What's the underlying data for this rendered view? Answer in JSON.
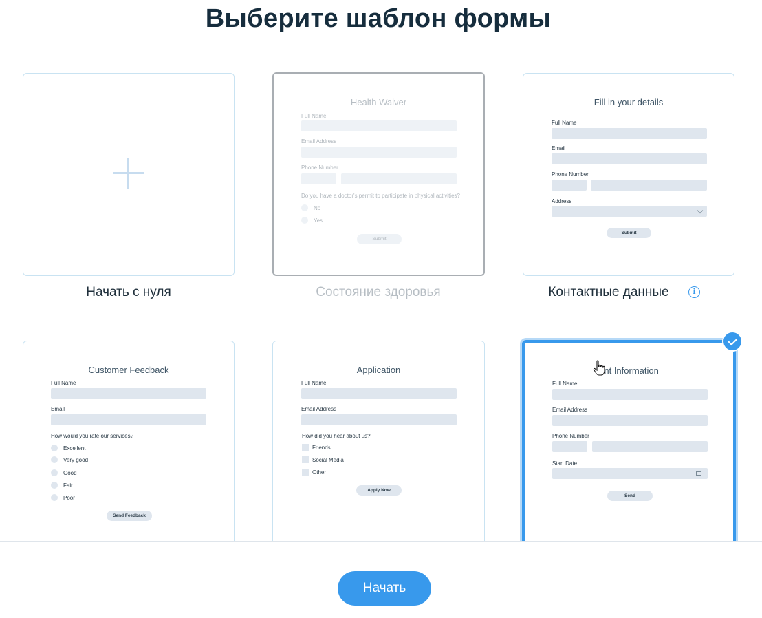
{
  "header": {
    "title": "Выберите шаблон формы"
  },
  "templates": [
    {
      "caption": "Начать с нуля"
    },
    {
      "caption": "Состояние здоровья",
      "form_title": "Health Waiver",
      "labels": [
        "Full Name",
        "Email Address",
        "Phone Number"
      ],
      "question": "Do you have a doctor's permit to participate in physical activities?",
      "options": [
        "No",
        "Yes"
      ],
      "button": "Submit"
    },
    {
      "caption": "Контактные данные",
      "form_title": "Fill in your details",
      "labels": [
        "Full Name",
        "Email",
        "Phone Number",
        "Address"
      ],
      "button": "Submit"
    },
    {
      "form_title": "Customer Feedback",
      "labels": [
        "Full Name",
        "Email"
      ],
      "question": "How would you rate our services?",
      "options": [
        "Excellent",
        "Very good",
        "Good",
        "Fair",
        "Poor"
      ],
      "button": "Send Feedback"
    },
    {
      "form_title": "Application",
      "labels": [
        "Full Name",
        "Email Address"
      ],
      "question": "How did you hear about us?",
      "options": [
        "Friends",
        "Social Media",
        "Other"
      ],
      "button": "Apply Now"
    },
    {
      "form_title": "ent Information",
      "labels": [
        "Full Name",
        "Email Address",
        "Phone Number",
        "Start Date"
      ],
      "button": "Send"
    }
  ],
  "footer": {
    "start_label": "Начать"
  },
  "colors": {
    "accent": "#3899ec",
    "title": "#162d3d",
    "field": "#dfe6ee"
  }
}
